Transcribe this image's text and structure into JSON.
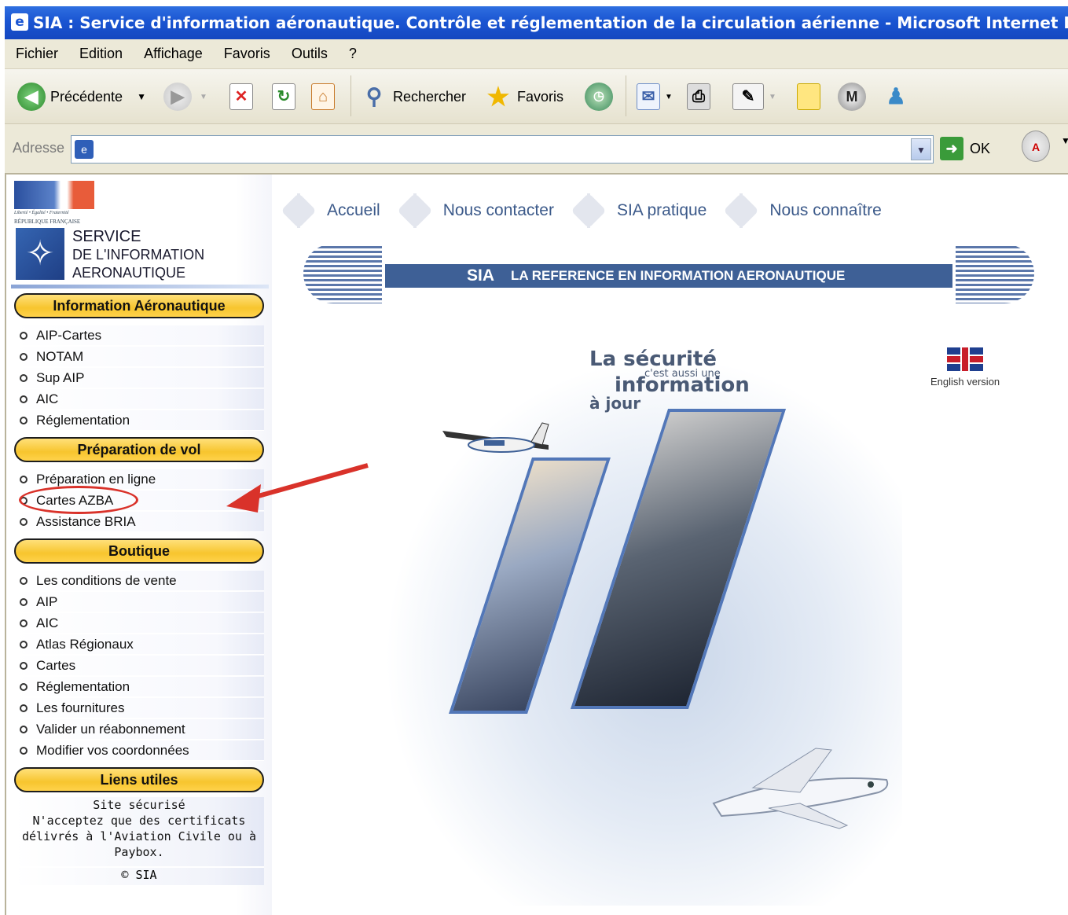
{
  "window": {
    "title": "SIA : Service d'information aéronautique. Contrôle et réglementation de la circulation aérienne - Microsoft Internet Explorer"
  },
  "menu": [
    "Fichier",
    "Edition",
    "Affichage",
    "Favoris",
    "Outils",
    "?"
  ],
  "toolbar": {
    "back_label": "Précédente",
    "search_label": "Rechercher",
    "favorites_label": "Favoris"
  },
  "address": {
    "label": "Adresse",
    "value": "",
    "go_label": "OK"
  },
  "logo": {
    "devise": "Liberté • Égalité • Fraternité",
    "republique": "RÉPUBLIQUE FRANÇAISE",
    "line1": "SERVICE",
    "line2": "DE L'INFORMATION",
    "line3": "AERONAUTIQUE"
  },
  "nav": [
    "Accueil",
    "Nous contacter",
    "SIA pratique",
    "Nous connaître"
  ],
  "banner": {
    "sia": "SIA",
    "tagline": "LA REFERENCE EN INFORMATION AERONAUTIQUE"
  },
  "sidebar": {
    "section1": {
      "title": "Information Aéronautique",
      "items": [
        "AIP-Cartes",
        "NOTAM",
        "Sup AIP",
        "AIC",
        "Réglementation"
      ]
    },
    "section2": {
      "title": "Préparation de vol",
      "items": [
        "Préparation en ligne",
        "Cartes AZBA",
        "Assistance BRIA"
      ]
    },
    "section3": {
      "title": "Boutique",
      "items": [
        "Les conditions de vente",
        "AIP",
        "AIC",
        "Atlas Régionaux",
        "Cartes",
        "Réglementation",
        "Les fournitures",
        "Valider un réabonnement",
        "Modifier vos coordonnées"
      ]
    },
    "section4": {
      "title": "Liens utiles"
    },
    "secure_lines": [
      "Site sécurisé",
      "N'acceptez que des certificats",
      "délivrés à l'Aviation Civile ou à",
      "Paybox."
    ],
    "copyright": "© SIA"
  },
  "hero": {
    "line1": "La sécurité",
    "line2": "c'est aussi une",
    "line3": "information",
    "line4": "à jour"
  },
  "english": "English version",
  "colors": {
    "title_bar": "#1a55d2",
    "pill": "#f7c52e",
    "banner": "#3e6096",
    "annotation": "#d9322a"
  }
}
